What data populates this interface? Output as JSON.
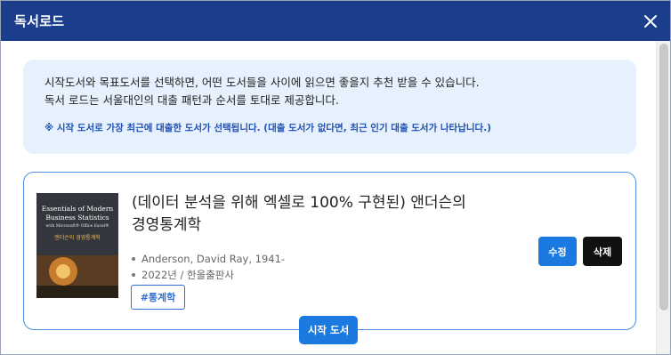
{
  "modal": {
    "title": "독서로드",
    "close_icon": "close-icon"
  },
  "notice": {
    "line1": "시작도서와 목표도서를 선택하면, 어떤 도서들을 사이에 읽으면 좋을지 추천 받을 수 있습니다.",
    "line2": "독서 로드는 서울대인의 대출 패턴과 순서를 토대로 제공합니다.",
    "hint": "※ 시작 도서로 가장 최근에 대출한 도서가 선택됩니다. (대출 도서가 없다면, 최근 인기 대출 도서가 나타납니다.)"
  },
  "book": {
    "title_line1": "(데이터 분석을 위해 엑셀로 100% 구현된) 앤더슨의",
    "title_line2": "경영통계학",
    "author": "Anderson, David Ray, 1941-",
    "publication": "2022년 / 한올출판사",
    "tag": "#통계학",
    "edit_label": "수정",
    "delete_label": "삭제",
    "cover": {
      "line1": "Essentials of Modern",
      "line2": "Business Statistics",
      "line3": "with Microsoft® Office Excel®",
      "line4": "앤더슨의 경영통계학"
    }
  },
  "start_badge": "시작 도서",
  "colors": {
    "header": "#1a3e8c",
    "accent": "#1b7ae0",
    "notice_bg": "#e6f1fd",
    "hint_text": "#1f4fb5"
  }
}
